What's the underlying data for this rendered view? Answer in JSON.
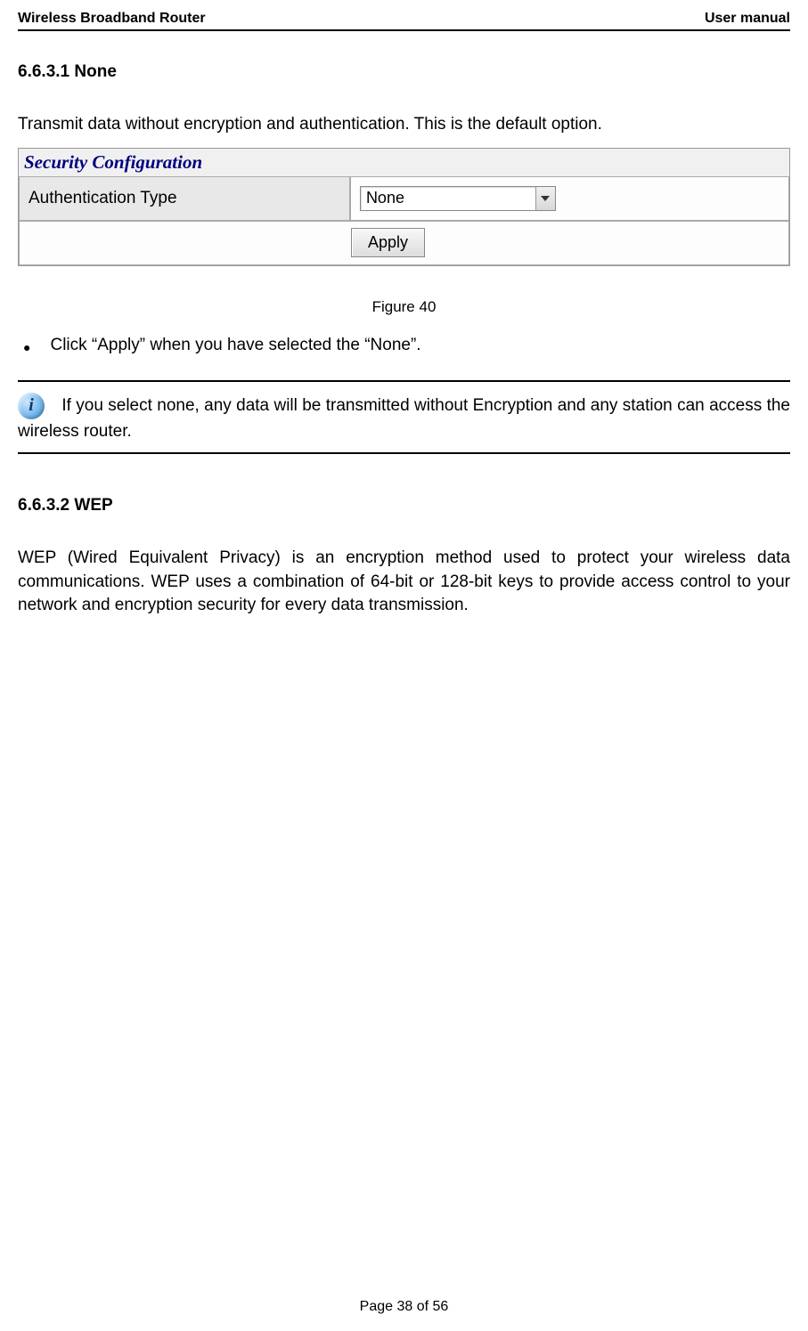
{
  "header": {
    "left": "Wireless Broadband Router",
    "right": "User manual"
  },
  "section1": {
    "heading": "6.6.3.1 None",
    "intro": "Transmit data without encryption and authentication. This is the default option."
  },
  "security_config": {
    "title": "Security Configuration",
    "auth_label": "Authentication Type",
    "auth_value": "None",
    "apply_label": "Apply"
  },
  "figure_caption": "Figure 40",
  "bullet1": "Click “Apply” when you have selected the “None”.",
  "info_note": " If you select none, any data will be transmitted without Encryption and any station can access the wireless router.",
  "info_icon_glyph": "i",
  "section2": {
    "heading": "6.6.3.2 WEP",
    "body": "WEP (Wired Equivalent Privacy) is an encryption method used to protect your wireless data communications. WEP uses a combination of 64-bit or 128-bit keys to provide access control to your network and encryption security for every data transmission."
  },
  "footer": "Page 38 of 56"
}
